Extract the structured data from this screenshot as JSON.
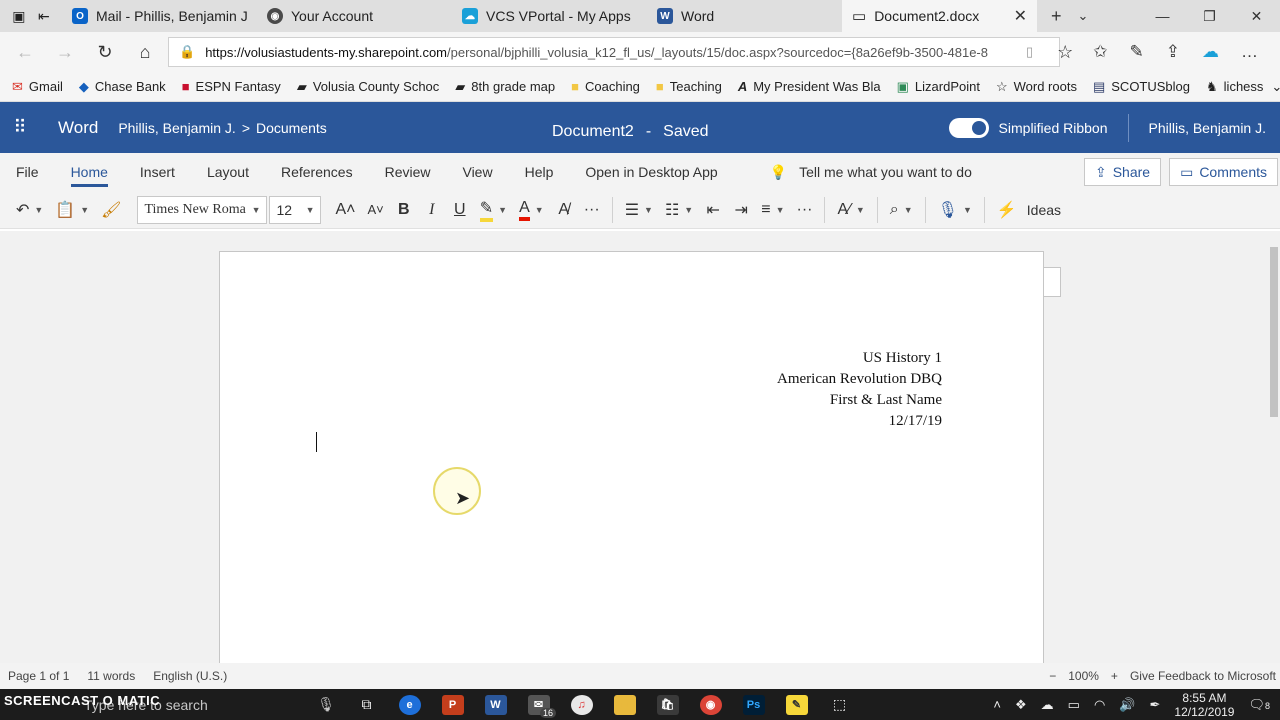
{
  "browser": {
    "tabs": [
      {
        "label": "Mail - Phillis, Benjamin J. -",
        "icon": "outlook-icon",
        "color": "#0a64c8"
      },
      {
        "label": "Your Account",
        "icon": "account-icon",
        "color": "#4a4a4a"
      },
      {
        "label": "VCS VPortal - My Apps",
        "icon": "vportal-icon",
        "color": "#1aa0d8"
      },
      {
        "label": "Word",
        "icon": "word-icon",
        "color": "#2b579a"
      },
      {
        "label": "Document2.docx",
        "icon": "page-icon",
        "color": "#777777",
        "selected": true
      }
    ],
    "url": {
      "host": "https://volusiastudents-my.sharepoint.com",
      "path": "/personal/bjphilli_volusia_k12_fl_us/_layouts/15/doc.aspx?sourcedoc={8a26ef9b-3500-481e-8"
    },
    "favorites": [
      {
        "label": "Gmail",
        "color": "#d93025"
      },
      {
        "label": "Chase Bank",
        "color": "#1560bd"
      },
      {
        "label": "ESPN Fantasy",
        "color": "#c8102e"
      },
      {
        "label": "Volusia County Schoc",
        "color": "#222222"
      },
      {
        "label": "8th grade map",
        "color": "#222222"
      },
      {
        "label": "Coaching",
        "color": "#f2c744"
      },
      {
        "label": "Teaching",
        "color": "#f2c744"
      },
      {
        "label": "My President Was Bla",
        "color": "#222222"
      },
      {
        "label": "LizardPoint",
        "color": "#2e8b57"
      },
      {
        "label": "Word roots",
        "color": "#444444"
      },
      {
        "label": "SCOTUSblog",
        "color": "#2b3a67"
      },
      {
        "label": "lichess",
        "color": "#333333"
      }
    ]
  },
  "word": {
    "app_name": "Word",
    "breadcrumb_user": "Phillis, Benjamin J.",
    "breadcrumb_sep": ">",
    "breadcrumb_folder": "Documents",
    "doc_name": "Document2",
    "doc_sep": "-",
    "doc_status": "Saved",
    "ribbon_toggle_label": "Simplified Ribbon",
    "user_name": "Phillis, Benjamin J.",
    "tabs": [
      "File",
      "Home",
      "Insert",
      "Layout",
      "References",
      "Review",
      "View",
      "Help",
      "Open in Desktop App"
    ],
    "selected_tab": "Home",
    "tell_me": "Tell me what you want to do",
    "share_label": "Share",
    "comments_label": "Comments",
    "font_name": "Times New Roma",
    "font_size": "12",
    "ideas_label": "Ideas"
  },
  "document": {
    "heading_lines": [
      "US History 1",
      "American Revolution DBQ",
      "First & Last Name",
      "12/17/19"
    ]
  },
  "status": {
    "page": "Page 1 of 1",
    "words": "11 words",
    "language": "English (U.S.)",
    "zoom": "100%",
    "feedback": "Give Feedback to Microsoft"
  },
  "taskbar": {
    "search_placeholder": "Type here to search",
    "watermark": "SCREENCAST O MATIC",
    "mail_badge": "16",
    "time": "8:55 AM",
    "date": "12/12/2019",
    "notification_count": "8"
  },
  "colors": {
    "word_blue": "#2b579a",
    "highlight": "#f6d73a",
    "font_red": "#e51400"
  }
}
